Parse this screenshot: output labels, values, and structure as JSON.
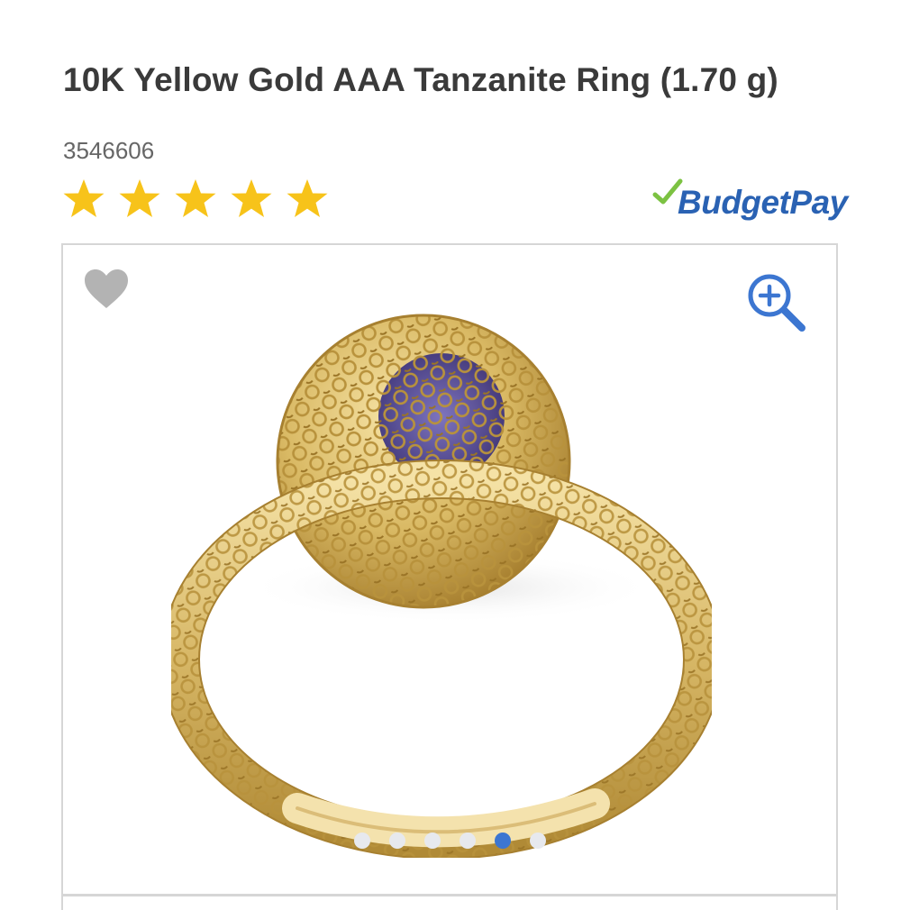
{
  "product": {
    "title": "10K Yellow Gold AAA Tanzanite Ring (1.70 g)",
    "sku": "3546606",
    "rating": {
      "stars": 5,
      "max": 5
    }
  },
  "payment": {
    "brand_label": "BudgetPay",
    "brand_color": "#2a62b3",
    "check_color": "#7cc242"
  },
  "gallery": {
    "wishlist_icon": "heart-icon",
    "zoom_icon": "zoom-in-icon",
    "image_count": 6,
    "active_index": 4
  },
  "colors": {
    "star": "#f7c31a",
    "accent": "#3c76d1",
    "heart": "#b3b3b3",
    "border": "#d6d6d6"
  }
}
